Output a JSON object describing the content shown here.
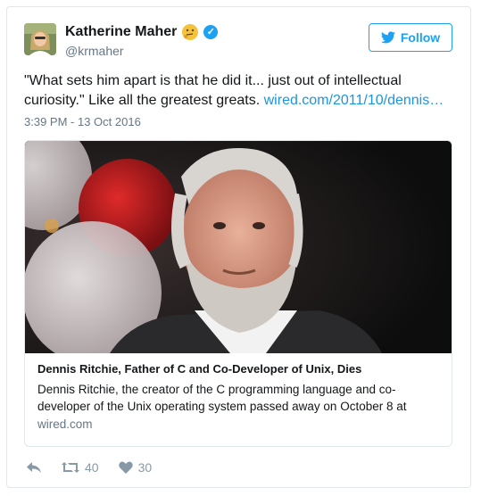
{
  "user": {
    "name": "Katherine Maher",
    "handle": "@krmaher"
  },
  "follow": {
    "label": "Follow"
  },
  "tweet": {
    "text": "\"What sets him apart is that he did it... just out of intellectual curiosity.\" Like all the greatest greats. ",
    "link": "wired.com/2011/10/dennis…",
    "timestamp": "3:39 PM - 13 Oct 2016"
  },
  "card": {
    "title": "Dennis Ritchie, Father of C and Co-Developer of Unix, Dies",
    "description": "Dennis Ritchie, the creator of the C programming language and co-developer of the Unix operating system passed away on October 8 at",
    "domain": "wired.com"
  },
  "actions": {
    "retweets": "40",
    "likes": "30"
  },
  "colors": {
    "accent": "#1da1f2",
    "link": "#1b95e0",
    "muted": "#657786"
  }
}
